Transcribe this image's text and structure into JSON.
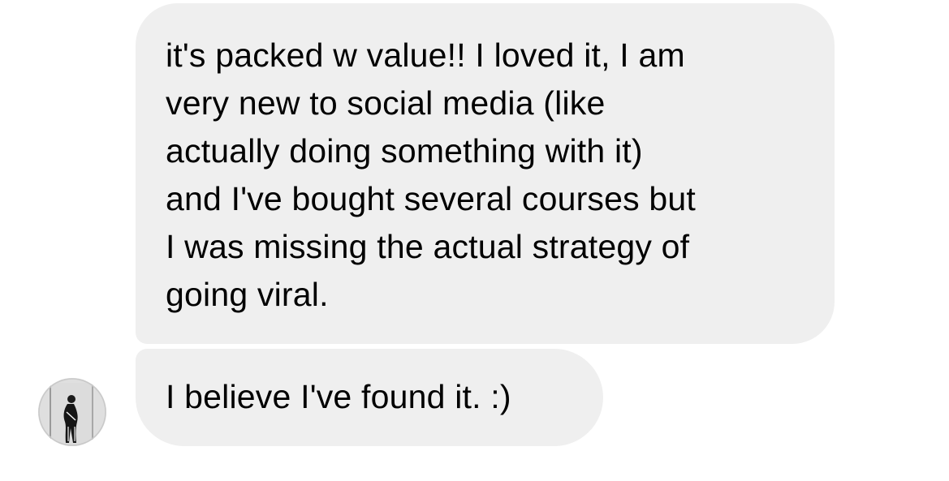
{
  "colors": {
    "bubble_background": "#EFEFEF",
    "text": "#000000",
    "page_background": "#FFFFFF"
  },
  "messages": [
    {
      "lines": [
        "it's packed w value!! I loved it, I am",
        "very new to social media (like",
        "actually doing something with it)",
        "and I've bought several courses but",
        "I was missing the actual strategy of",
        "going viral."
      ]
    },
    {
      "lines": [
        "I believe I've found it. :)"
      ]
    }
  ],
  "avatar": {
    "icon": "profile-photo-icon"
  }
}
